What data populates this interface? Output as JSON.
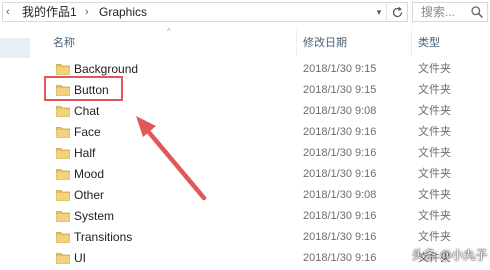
{
  "address_bar": {
    "chevron_icon": "chevron-left-icon",
    "breadcrumb": [
      "我的作品1",
      "Graphics"
    ],
    "separator": "›",
    "dropdown_icon": "chevron-down-icon",
    "refresh_icon": "refresh-icon"
  },
  "search": {
    "placeholder": "搜索...",
    "icon": "search-icon"
  },
  "columns": {
    "name": "名称",
    "date": "修改日期",
    "type": "类型"
  },
  "files": [
    {
      "name": "Background",
      "date": "2018/1/30 9:15",
      "type": "文件夹"
    },
    {
      "name": "Button",
      "date": "2018/1/30 9:15",
      "type": "文件夹"
    },
    {
      "name": "Chat",
      "date": "2018/1/30 9:08",
      "type": "文件夹"
    },
    {
      "name": "Face",
      "date": "2018/1/30 9:16",
      "type": "文件夹"
    },
    {
      "name": "Half",
      "date": "2018/1/30 9:16",
      "type": "文件夹"
    },
    {
      "name": "Mood",
      "date": "2018/1/30 9:16",
      "type": "文件夹"
    },
    {
      "name": "Other",
      "date": "2018/1/30 9:08",
      "type": "文件夹"
    },
    {
      "name": "System",
      "date": "2018/1/30 9:16",
      "type": "文件夹"
    },
    {
      "name": "Transitions",
      "date": "2018/1/30 9:16",
      "type": "文件夹"
    },
    {
      "name": "UI",
      "date": "2018/1/30 9:16",
      "type": "文件夹"
    }
  ],
  "highlighted_item": "Button",
  "annotation_color": "#e05858",
  "folder_color": "#e8c25a",
  "watermark": "头条 @小丸子"
}
